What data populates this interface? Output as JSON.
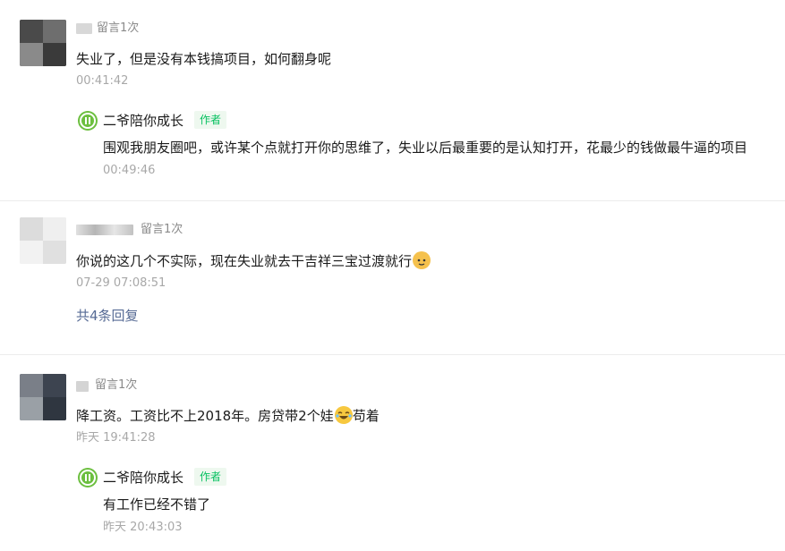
{
  "comments": [
    {
      "tag": "留言1次",
      "text": "失业了，但是没有本钱搞项目，如何翻身呢",
      "time": "00:41:42",
      "reply": {
        "author": "二爷陪你成长",
        "badge": "作者",
        "text": "围观我朋友圈吧，或许某个点就打开你的思维了，失业以后最重要的是认知打开，花最少的钱做最牛逼的项目",
        "time": "00:49:46"
      }
    },
    {
      "tag": "留言1次",
      "text": "你说的这几个不实际，现在失业就去干吉祥三宝过渡就行",
      "emoji": "cat-face-emoji",
      "time": "07-29 07:08:51",
      "more": "共4条回复"
    },
    {
      "tag": "留言1次",
      "text_before": "降工资。工资比不上2018年。房贷带2个娃",
      "emoji": "laughing-face-emoji",
      "text_after": "苟着",
      "time": "昨天 19:41:28",
      "reply": {
        "author": "二爷陪你成长",
        "badge": "作者",
        "text": "有工作已经不错了",
        "time": "昨天 20:43:03"
      }
    }
  ],
  "colors": {
    "link": "#576b95",
    "author_badge": "#07c160",
    "author_icon": "#6cbf3f",
    "meta": "#a8a8a8"
  }
}
